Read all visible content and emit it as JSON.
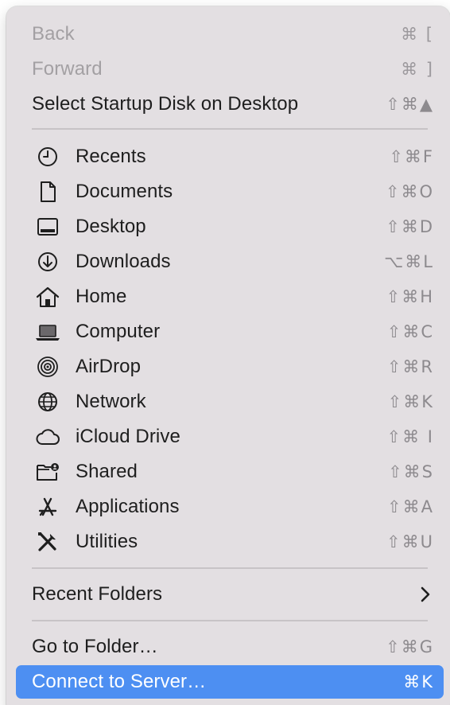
{
  "menu": {
    "nav": [
      {
        "label": "Back",
        "shortcut": "⌘ [",
        "disabled": true
      },
      {
        "label": "Forward",
        "shortcut": "⌘ ]",
        "disabled": true
      },
      {
        "label": "Select Startup Disk on Desktop",
        "shortcut": "⇧⌘▲",
        "disabled": false
      }
    ],
    "places": [
      {
        "label": "Recents",
        "shortcut": "⇧⌘F",
        "icon": "clock-icon"
      },
      {
        "label": "Documents",
        "shortcut": "⇧⌘O",
        "icon": "document-icon"
      },
      {
        "label": "Desktop",
        "shortcut": "⇧⌘D",
        "icon": "desktop-icon"
      },
      {
        "label": "Downloads",
        "shortcut": "⌥⌘L",
        "icon": "download-icon"
      },
      {
        "label": "Home",
        "shortcut": "⇧⌘H",
        "icon": "home-icon"
      },
      {
        "label": "Computer",
        "shortcut": "⇧⌘C",
        "icon": "laptop-icon"
      },
      {
        "label": "AirDrop",
        "shortcut": "⇧⌘R",
        "icon": "airdrop-icon"
      },
      {
        "label": "Network",
        "shortcut": "⇧⌘K",
        "icon": "globe-icon"
      },
      {
        "label": "iCloud Drive",
        "shortcut": "⇧⌘ I",
        "icon": "cloud-icon"
      },
      {
        "label": "Shared",
        "shortcut": "⇧⌘S",
        "icon": "shared-folder-icon"
      },
      {
        "label": "Applications",
        "shortcut": "⇧⌘A",
        "icon": "applications-icon"
      },
      {
        "label": "Utilities",
        "shortcut": "⇧⌘U",
        "icon": "utilities-icon"
      }
    ],
    "recent_folders": {
      "label": "Recent Folders",
      "icon": "chevron-right-icon"
    },
    "go_to_folder": {
      "label": "Go to Folder…",
      "shortcut": "⇧⌘G"
    },
    "connect_to_server": {
      "label": "Connect to Server…",
      "shortcut": "⌘K",
      "highlighted": true
    },
    "colors": {
      "background": "#e3dfe2",
      "highlight": "#4d8ff2",
      "text": "#1e1e1e",
      "disabled_text": "#a3a0a3",
      "shortcut_text": "#8d8a8e"
    }
  }
}
